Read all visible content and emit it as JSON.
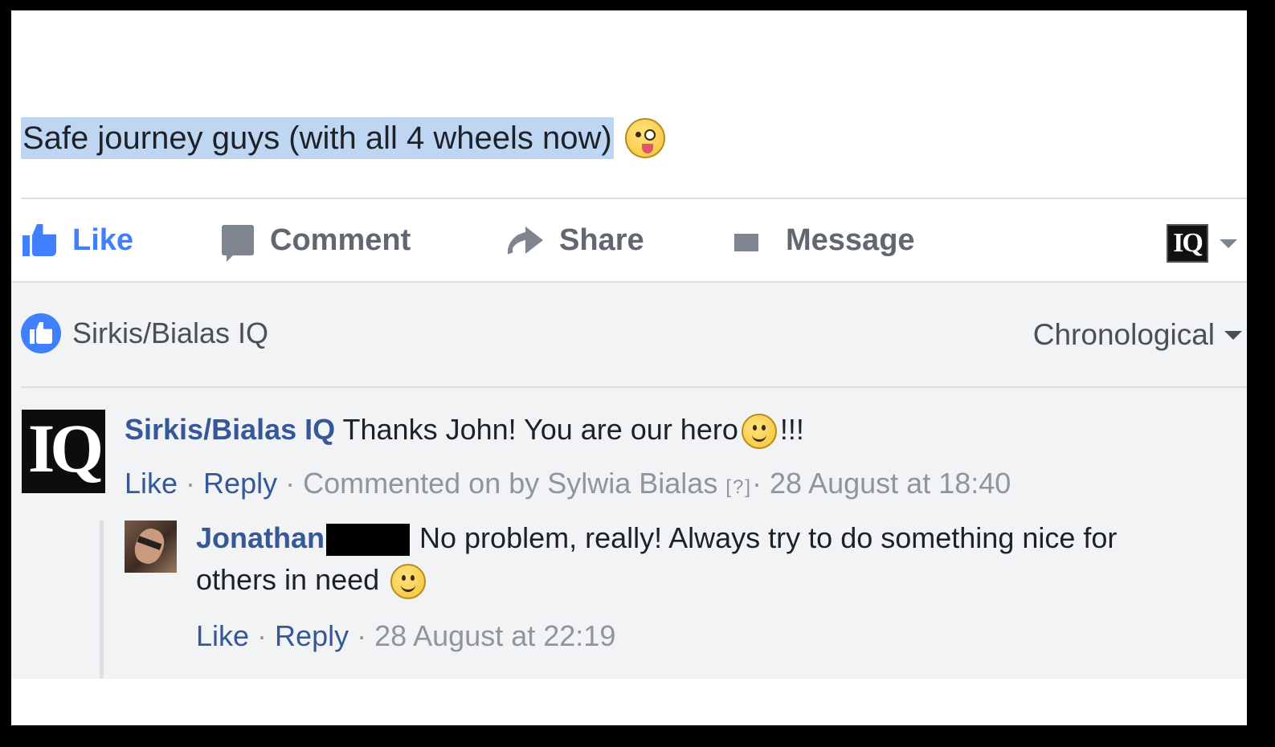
{
  "post": {
    "text": "Safe journey guys (with all 4 wheels now)",
    "emoji": "tongue-wink-emoji"
  },
  "actions": {
    "like": "Like",
    "comment": "Comment",
    "share": "Share",
    "message": "Message",
    "page_selector": "IQ"
  },
  "likes": {
    "by": "Sirkis/Bialas IQ"
  },
  "sort": {
    "label": "Chronological"
  },
  "comments": [
    {
      "avatar_text": "IQ",
      "author": "Sirkis/Bialas IQ",
      "text_before": "Thanks John! You are our hero",
      "text_after": "!!!",
      "like": "Like",
      "reply": "Reply",
      "commented_on_by": "Commented on by Sylwia Bialas",
      "qmark": "[?]",
      "time": "28 August at 18:40"
    },
    {
      "author": "Jonathan",
      "text": "No problem, really! Always try to do something nice for others in need",
      "like": "Like",
      "reply": "Reply",
      "time": "28 August at 22:19"
    }
  ],
  "colors": {
    "link": "#365899",
    "like_blue": "#4080ff",
    "muted": "#90949c",
    "selection": "#bfd6f2"
  }
}
